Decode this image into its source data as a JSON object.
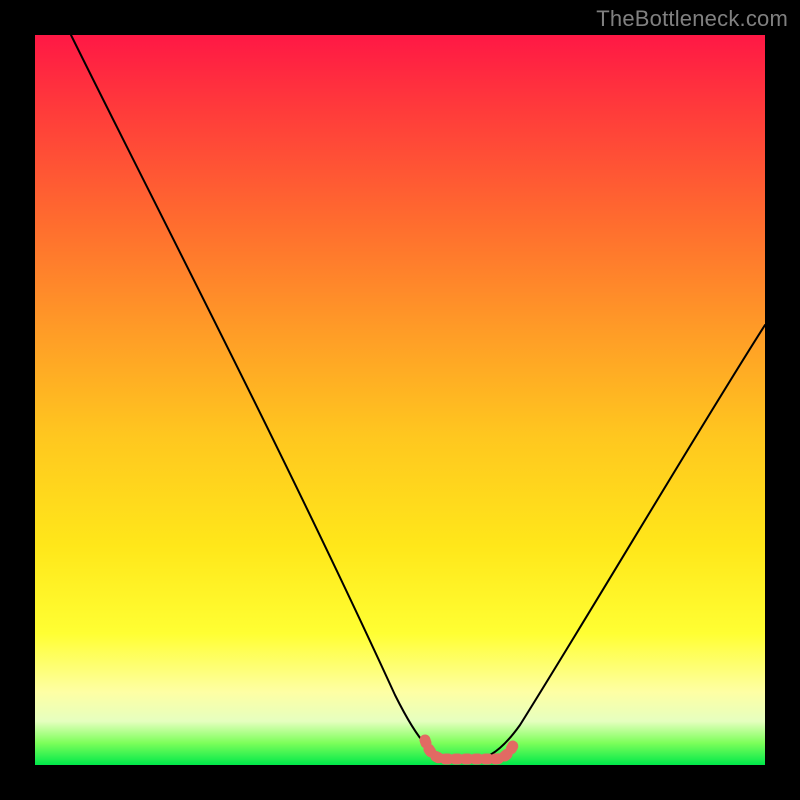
{
  "watermark": {
    "text": "TheBottleneck.com"
  },
  "colors": {
    "curve": "#000000",
    "marker": "#e26a63",
    "background": "#000000"
  },
  "chart_data": {
    "type": "line",
    "title": "",
    "xlabel": "",
    "ylabel": "",
    "xlim": [
      0,
      100
    ],
    "ylim": [
      0,
      100
    ],
    "grid": false,
    "series": [
      {
        "name": "bottleneck-curve",
        "x": [
          5,
          10,
          15,
          20,
          25,
          30,
          35,
          40,
          45,
          50,
          53,
          55,
          57,
          60,
          63,
          65,
          70,
          75,
          80,
          85,
          90,
          95,
          100
        ],
        "y": [
          100,
          90,
          80,
          70,
          60,
          50,
          41,
          32,
          23,
          13,
          7,
          3,
          1,
          0,
          1,
          3,
          10,
          19,
          28,
          37,
          46,
          54,
          62
        ]
      }
    ],
    "marker": {
      "name": "optimal-range",
      "x_range": [
        55,
        64
      ],
      "y": 1
    },
    "background_gradient": {
      "stops": [
        {
          "pos": 0,
          "color": "#ff1845"
        },
        {
          "pos": 10,
          "color": "#ff3a3b"
        },
        {
          "pos": 25,
          "color": "#ff6a2f"
        },
        {
          "pos": 40,
          "color": "#ff9a27"
        },
        {
          "pos": 55,
          "color": "#ffc71f"
        },
        {
          "pos": 70,
          "color": "#ffe71a"
        },
        {
          "pos": 82,
          "color": "#ffff33"
        },
        {
          "pos": 90,
          "color": "#feffa4"
        },
        {
          "pos": 94,
          "color": "#e6ffbf"
        },
        {
          "pos": 97,
          "color": "#7cff5a"
        },
        {
          "pos": 100,
          "color": "#00e84a"
        }
      ]
    }
  }
}
